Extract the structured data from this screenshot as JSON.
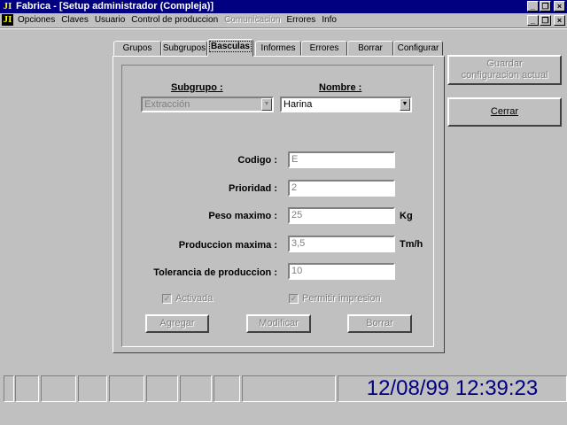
{
  "window": {
    "title": "Fabrica - [Setup administrador (Compleja)]",
    "icon_text": "JI",
    "minimize": "_",
    "restore": "❐",
    "close": "×"
  },
  "menu": {
    "items": [
      {
        "label": "Opciones",
        "enabled": true
      },
      {
        "label": "Claves",
        "enabled": true
      },
      {
        "label": "Usuario",
        "enabled": true
      },
      {
        "label": "Control de produccion",
        "enabled": true
      },
      {
        "label": "Comunicacion",
        "enabled": false
      },
      {
        "label": "Errores",
        "enabled": true
      },
      {
        "label": "Info",
        "enabled": true
      }
    ]
  },
  "tabs": [
    {
      "label": "Grupos",
      "active": false
    },
    {
      "label": "Subgrupos",
      "active": false
    },
    {
      "label": "Basculas",
      "active": true
    },
    {
      "label": "Informes",
      "active": false
    },
    {
      "label": "Errores",
      "active": false
    },
    {
      "label": "Borrar",
      "active": false
    },
    {
      "label": "Configurar",
      "active": false
    }
  ],
  "form": {
    "subgrupo_label": "Subgrupo :",
    "subgrupo_value": "Extracción",
    "nombre_label": "Nombre :",
    "nombre_value": "Harina",
    "codigo_label": "Codigo :",
    "codigo_value": "E",
    "prioridad_label": "Prioridad :",
    "prioridad_value": "2",
    "peso_label": "Peso maximo :",
    "peso_value": "25",
    "peso_unit": "Kg",
    "produccion_label": "Produccion maxima :",
    "produccion_value": "3,5",
    "produccion_unit": "Tm/h",
    "tolerancia_label": "Tolerancia de produccion :",
    "tolerancia_value": "10",
    "activada_label": "Activada",
    "activada_checked": true,
    "permitir_label": "Permitir impresion",
    "permitir_checked": true,
    "agregar_label": "Agregar",
    "modificar_label": "Modificar",
    "borrar_label": "Borrar"
  },
  "side": {
    "guardar_line1": "Guardar",
    "guardar_line2": "configuracion actual",
    "cerrar_label": "Cerrar"
  },
  "status": {
    "datetime": "12/08/99 12:39:23"
  }
}
